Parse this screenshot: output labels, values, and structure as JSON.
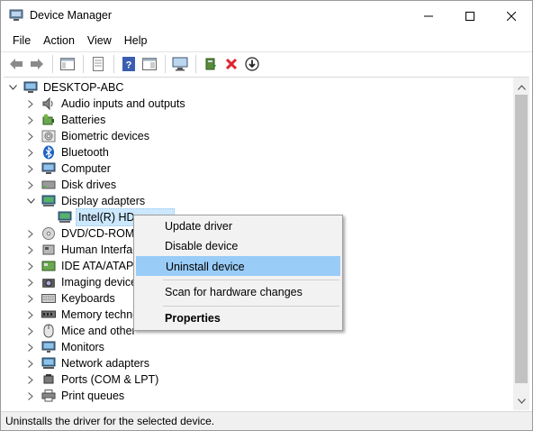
{
  "window": {
    "title": "Device Manager",
    "controls": [
      "minimize",
      "maximize",
      "close"
    ]
  },
  "menubar": {
    "items": [
      "File",
      "Action",
      "View",
      "Help"
    ]
  },
  "toolbar": {
    "buttons": [
      "back-arrow-icon",
      "forward-arrow-icon",
      "show-hide-console-tree-icon",
      "properties-icon",
      "help-icon",
      "action-pane-icon",
      "scan-monitor-icon",
      "update-driver-icon",
      "uninstall-x-icon",
      "download-driver-icon"
    ]
  },
  "tree": {
    "root": "DESKTOP-ABC",
    "items": [
      {
        "label": "Audio inputs and outputs",
        "icon": "speaker-icon"
      },
      {
        "label": "Batteries",
        "icon": "battery-icon"
      },
      {
        "label": "Biometric devices",
        "icon": "fingerprint-icon"
      },
      {
        "label": "Bluetooth",
        "icon": "bluetooth-icon"
      },
      {
        "label": "Computer",
        "icon": "computer-icon"
      },
      {
        "label": "Disk drives",
        "icon": "disk-drive-icon"
      },
      {
        "label": "Display adapters",
        "icon": "display-adapter-icon",
        "expanded": true
      },
      {
        "label": "Intel(R) HD",
        "icon": "display-adapter-icon",
        "child": true,
        "selected": true
      },
      {
        "label": "DVD/CD-ROM",
        "icon": "dvd-icon"
      },
      {
        "label": "Human Interfac",
        "icon": "hid-icon"
      },
      {
        "label": "IDE ATA/ATAPI",
        "icon": "ide-icon"
      },
      {
        "label": "Imaging device",
        "icon": "camera-icon"
      },
      {
        "label": "Keyboards",
        "icon": "keyboard-icon"
      },
      {
        "label": "Memory techno",
        "icon": "memory-icon"
      },
      {
        "label": "Mice and other",
        "icon": "mouse-icon"
      },
      {
        "label": "Monitors",
        "icon": "monitor-icon"
      },
      {
        "label": "Network adapters",
        "icon": "network-icon"
      },
      {
        "label": "Ports (COM & LPT)",
        "icon": "port-icon"
      },
      {
        "label": "Print queues",
        "icon": "printer-icon"
      }
    ]
  },
  "context_menu": {
    "items": [
      {
        "label": "Update driver"
      },
      {
        "label": "Disable device"
      },
      {
        "label": "Uninstall device",
        "highlighted": true
      },
      {
        "label": "Scan for hardware changes"
      },
      {
        "label": "Properties",
        "bold": true
      }
    ]
  },
  "statusbar": {
    "text": "Uninstalls the driver for the selected device."
  },
  "colors": {
    "highlight": "#99ccf7",
    "selection": "#cce8ff",
    "menu_bg": "#f2f2f2",
    "uninstall_red": "#e0232e"
  }
}
